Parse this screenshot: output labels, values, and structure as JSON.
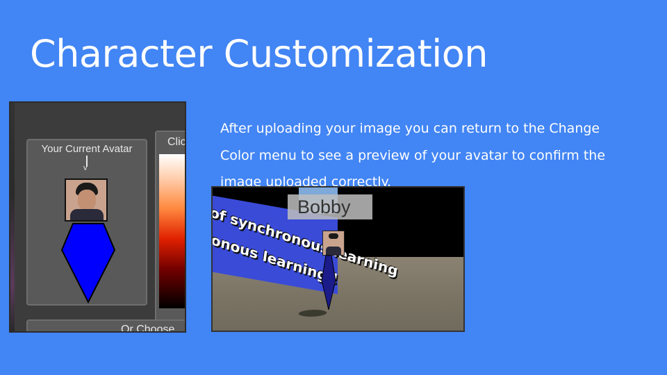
{
  "slide": {
    "title": "Character Customization",
    "body": "After uploading your image you can return to the Change Color menu to see a preview of your avatar to confirm the image uploaded correctly."
  },
  "menu_screenshot": {
    "avatar_label": "Your Current Avatar",
    "arrow": "v",
    "color_label": "Clic",
    "choose_label": "Or Choose",
    "avatar_color": "#0000ff"
  },
  "game_screenshot": {
    "banner_line_1": "of synchronous learning",
    "banner_line_2": "ronous learning !",
    "player_name": "Bobby",
    "avatar_color": "#0000ff"
  },
  "colors": {
    "background": "#4285f4",
    "text": "#ffffff"
  }
}
